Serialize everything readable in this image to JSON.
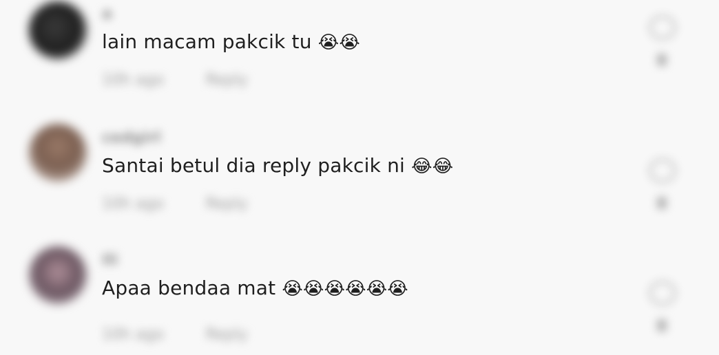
{
  "comments": [
    {
      "username": "a",
      "text": "lain macam pakcik tu",
      "emoji": "😭😭",
      "time": "10h ago",
      "reply_label": "Reply",
      "avatar_color": "#2a2a2a"
    },
    {
      "username": "cedgirl",
      "text": "Santai betul dia reply pakcik ni",
      "emoji": "😂😂",
      "time": "10h ago",
      "reply_label": "Reply",
      "avatar_color": "#8a6a5a"
    },
    {
      "username": "Ili",
      "text": "Apaa bendaa mat",
      "emoji": "😭😭😭😭😭😭",
      "time": "10h ago",
      "reply_label": "Reply",
      "avatar_color": "#6f5a66"
    }
  ]
}
